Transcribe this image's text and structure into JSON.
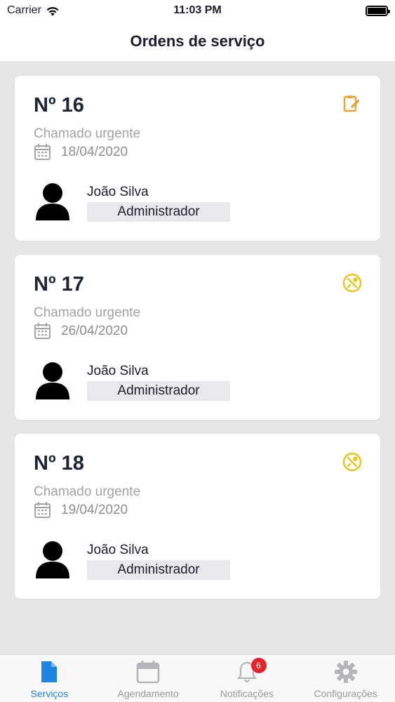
{
  "status_bar": {
    "carrier": "Carrier",
    "time": "11:03 PM"
  },
  "nav": {
    "title": "Ordens de serviço"
  },
  "orders": [
    {
      "number": "Nº 16",
      "subtitle": "Chamado urgente",
      "date": "18/04/2020",
      "user_name": "João Silva",
      "role": "Administrador",
      "status_icon": "clipboard-edit-icon",
      "status_color": "#f0a23a"
    },
    {
      "number": "Nº 17",
      "subtitle": "Chamado urgente",
      "date": "26/04/2020",
      "user_name": "João Silva",
      "role": "Administrador",
      "status_icon": "tools-circle-icon",
      "status_color": "#e8c318"
    },
    {
      "number": "Nº 18",
      "subtitle": "Chamado urgente",
      "date": "19/04/2020",
      "user_name": "João Silva",
      "role": "Administrador",
      "status_icon": "tools-circle-icon",
      "status_color": "#e8c318"
    }
  ],
  "tabs": [
    {
      "label": "Serviços",
      "icon": "document-icon",
      "active": true
    },
    {
      "label": "Agendamento",
      "icon": "calendar-icon",
      "active": false
    },
    {
      "label": "Notificações",
      "icon": "bell-icon",
      "active": false,
      "badge": "6"
    },
    {
      "label": "Configurações",
      "icon": "gear-icon",
      "active": false
    }
  ],
  "colors": {
    "accent": "#1e86e0",
    "inactive": "#9a9a9e",
    "badge": "#e8232b"
  }
}
